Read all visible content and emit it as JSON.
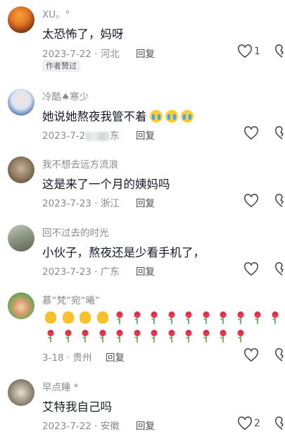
{
  "comments": [
    {
      "author": "XU。°",
      "text": "太恐怖了，妈呀",
      "date": "2023-7-22",
      "location": "河北",
      "reply": "回复",
      "likes": "1",
      "badge": "作者赞过"
    },
    {
      "author": "冷酷♠寒少",
      "text": "她说她熬夜我管不着",
      "date": "2023-7-2",
      "location": "东",
      "reply": "回复",
      "likes": ""
    },
    {
      "author": "我不想去远方流浪",
      "text": "这是来了一个月的姨妈吗",
      "date": "2023-7-23",
      "location": "浙江",
      "reply": "回复",
      "likes": ""
    },
    {
      "author": "回不过去的时光",
      "text": "小伙子，熬夜还是少看手机了，",
      "date": "2023-7-23",
      "location": "广东",
      "reply": "回复",
      "likes": ""
    },
    {
      "author": "慕“梵”宛“曦”",
      "text": "",
      "date": "3-18",
      "location": "贵州",
      "reply": "回复",
      "likes": ""
    },
    {
      "author": "早点睡 *",
      "text": "艾特我自己吗",
      "date": "2023-7-22",
      "location": "安徽",
      "reply": "回复",
      "likes": "2"
    }
  ],
  "emojis": {
    "crying_face_count": 3,
    "clap_count": 4,
    "rose_row1_count": 10,
    "rose_row2_count": 12
  },
  "icons": {
    "like": "heart-outline-icon",
    "dislike": "broken-heart-icon",
    "emoji_crying": "loudly-crying-face-icon",
    "emoji_clap": "clapping-hands-icon",
    "emoji_rose": "rose-icon"
  },
  "colors": {
    "text": "#161823",
    "meta": "#8a8b91",
    "reply": "#4e4f57",
    "badge_bg": "#f0f0f2"
  }
}
